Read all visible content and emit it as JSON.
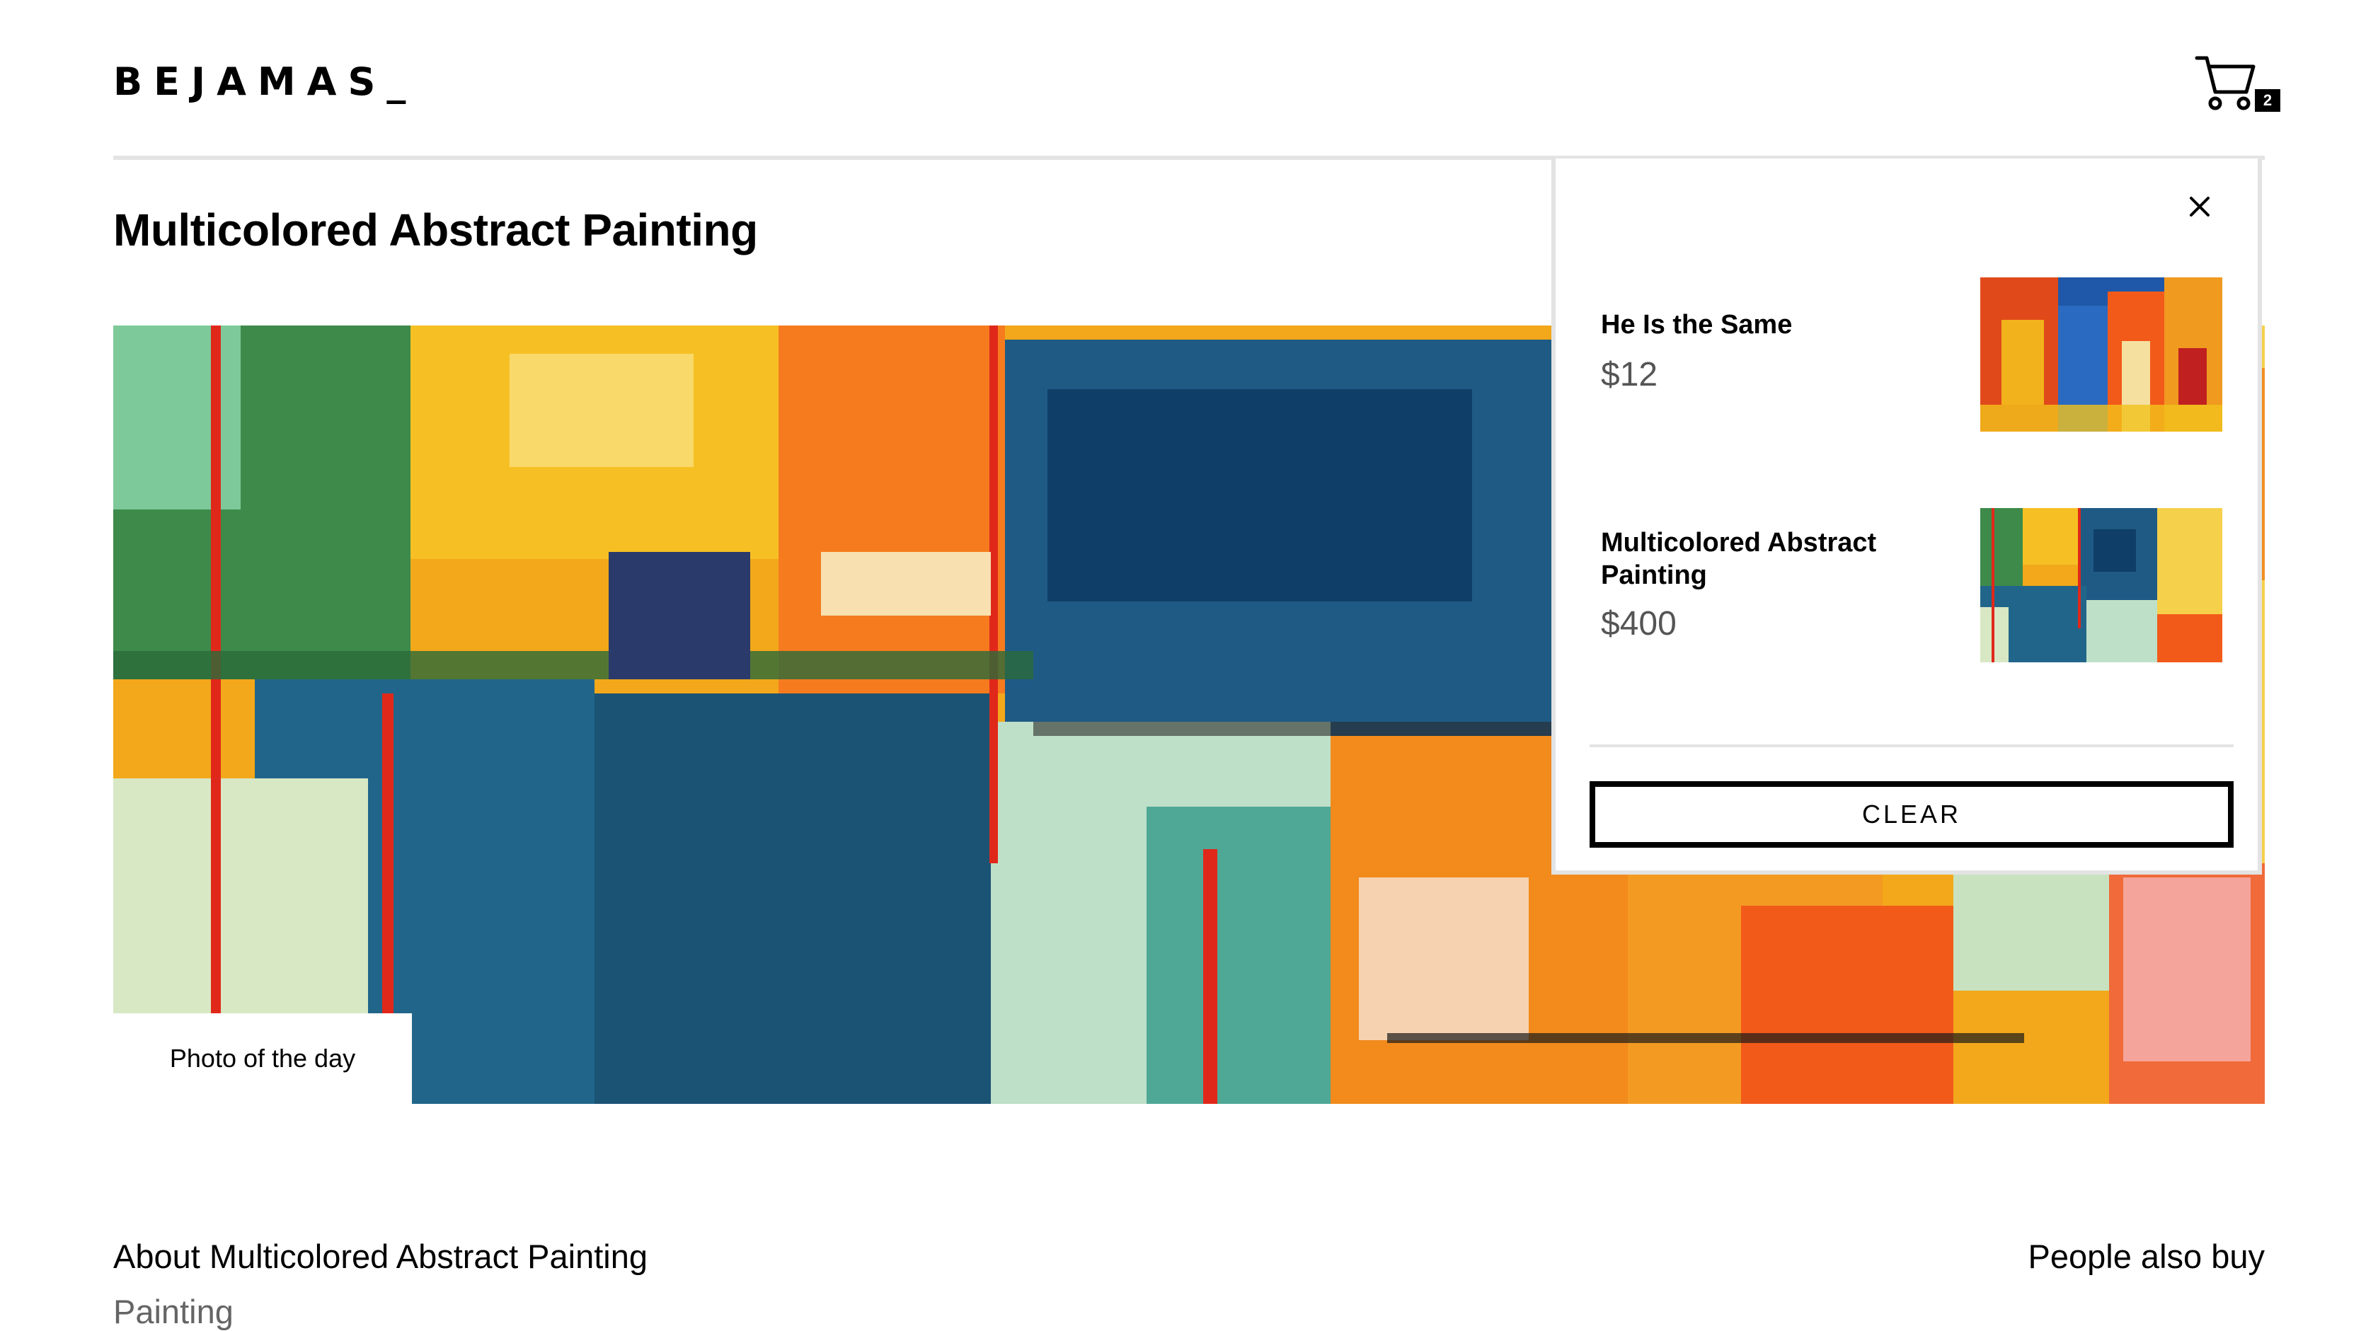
{
  "header": {
    "logo": "BEJAMAS_",
    "cart_count": "2",
    "cart_icon": "shopping-cart-icon"
  },
  "product": {
    "title": "Multicolored Abstract Painting",
    "photo_label": "Photo of the day"
  },
  "cart_panel": {
    "close_icon": "close-icon",
    "items": [
      {
        "name": "He Is the Same",
        "price": "$12"
      },
      {
        "name": "Multicolored Abstract Painting",
        "price": "$400"
      }
    ],
    "clear_label": "CLEAR"
  },
  "below": {
    "about_heading": "About Multicolored Abstract Painting",
    "category": "Painting",
    "people_also_buy": "People also buy"
  },
  "colors": {
    "accent": "#000000",
    "divider": "#e3e3e3",
    "price_gray": "#555555"
  }
}
